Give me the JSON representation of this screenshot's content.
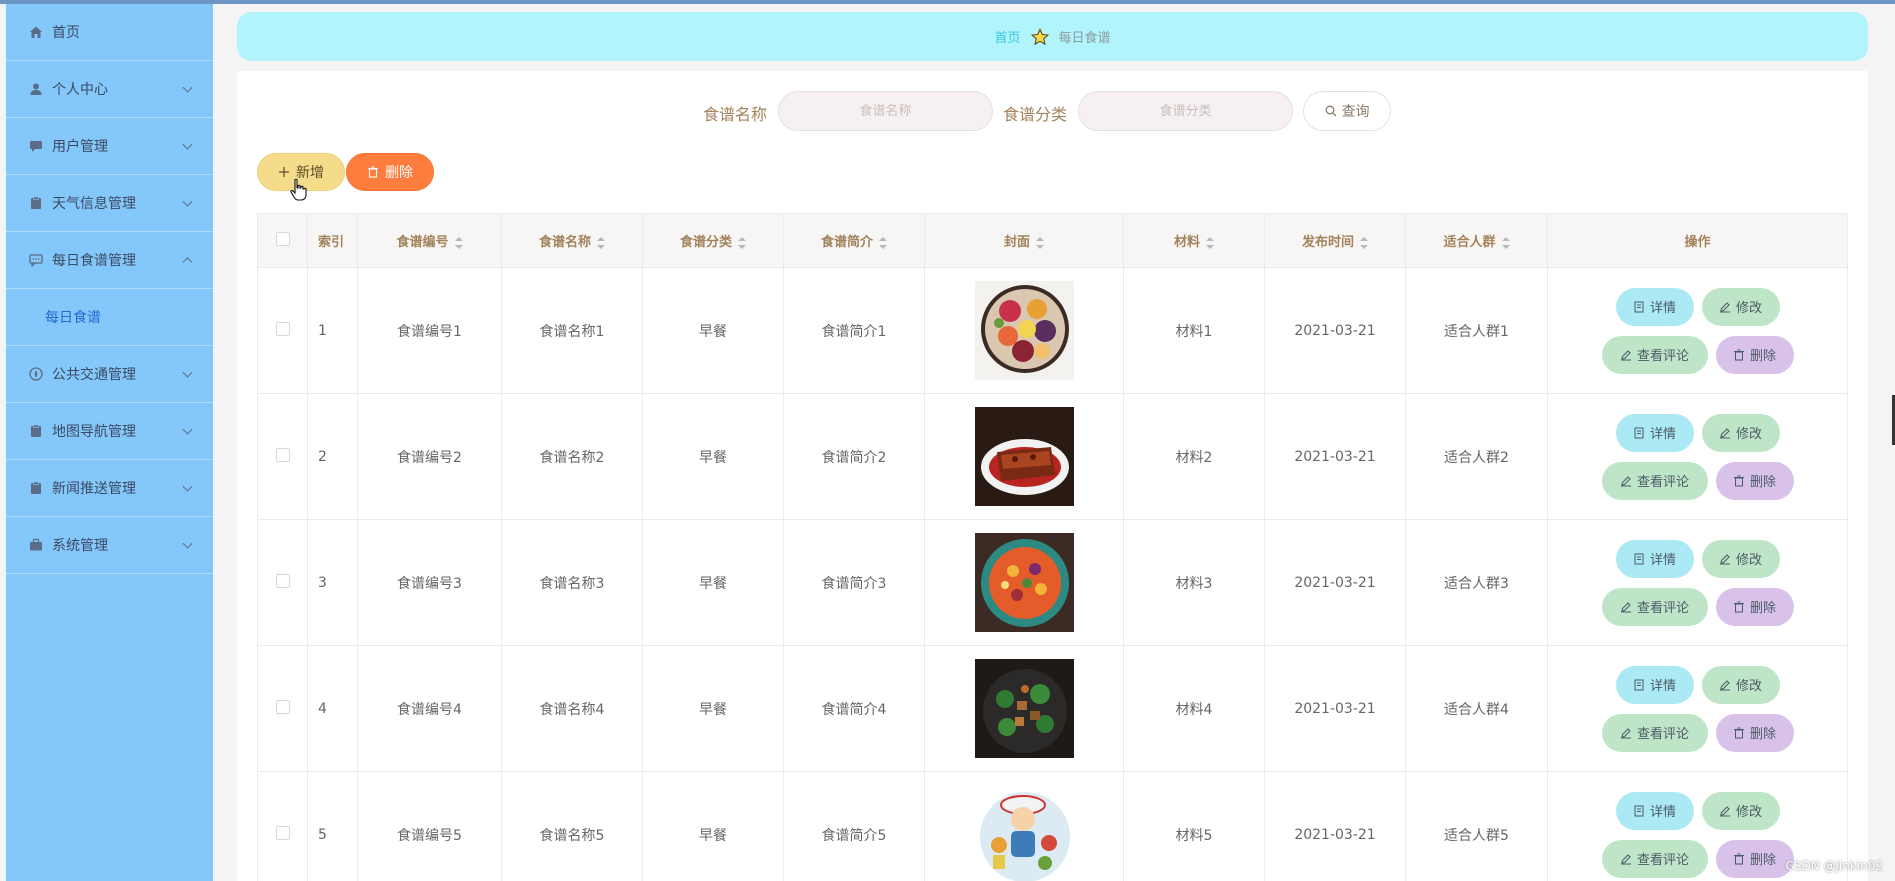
{
  "sidebar": {
    "items": [
      {
        "label": "首页"
      },
      {
        "label": "个人中心"
      },
      {
        "label": "用户管理"
      },
      {
        "label": "天气信息管理"
      },
      {
        "label": "每日食谱管理"
      },
      {
        "label": "公共交通管理"
      },
      {
        "label": "地图导航管理"
      },
      {
        "label": "新闻推送管理"
      },
      {
        "label": "系统管理"
      }
    ],
    "submenu": {
      "label": "每日食谱"
    }
  },
  "breadcrumb": {
    "home": "首页",
    "current": "每日食谱"
  },
  "search": {
    "name_label": "食谱名称",
    "name_placeholder": "食谱名称",
    "category_label": "食谱分类",
    "category_placeholder": "食谱分类",
    "query_label": "查询"
  },
  "toolbar": {
    "add_label": "新增",
    "delete_label": "删除"
  },
  "table": {
    "headers": {
      "index": "索引",
      "code": "食谱编号",
      "name": "食谱名称",
      "category": "食谱分类",
      "intro": "食谱简介",
      "cover": "封面",
      "material": "材料",
      "time": "发布时间",
      "crowd": "适合人群",
      "ops": "操作"
    },
    "ops_labels": {
      "detail": "详情",
      "edit": "修改",
      "comment": "查看评论",
      "remove": "删除"
    },
    "rows": [
      {
        "index": "1",
        "code": "食谱编号1",
        "name": "食谱名称1",
        "category": "早餐",
        "intro": "食谱简介1",
        "material": "材料1",
        "time": "2021-03-21",
        "crowd": "适合人群1"
      },
      {
        "index": "2",
        "code": "食谱编号2",
        "name": "食谱名称2",
        "category": "早餐",
        "intro": "食谱简介2",
        "material": "材料2",
        "time": "2021-03-21",
        "crowd": "适合人群2"
      },
      {
        "index": "3",
        "code": "食谱编号3",
        "name": "食谱名称3",
        "category": "早餐",
        "intro": "食谱简介3",
        "material": "材料3",
        "time": "2021-03-21",
        "crowd": "适合人群3"
      },
      {
        "index": "4",
        "code": "食谱编号4",
        "name": "食谱名称4",
        "category": "早餐",
        "intro": "食谱简介4",
        "material": "材料4",
        "time": "2021-03-21",
        "crowd": "适合人群4"
      },
      {
        "index": "5",
        "code": "食谱编号5",
        "name": "食谱名称5",
        "category": "早餐",
        "intro": "食谱简介5",
        "material": "材料5",
        "time": "2021-03-21",
        "crowd": "适合人群5"
      }
    ]
  },
  "watermark": "CSDN @jinkin02",
  "colors": {
    "sidebar_bg": "#84c7fa",
    "breadcrumb_bg": "#b2f4fc",
    "add_btn": "#f5dc8b",
    "delete_btn": "#fc7d3e",
    "detail_btn": "#abe9f4",
    "edit_btn": "#bfe5c8",
    "remove_btn": "#d9c2ea"
  }
}
